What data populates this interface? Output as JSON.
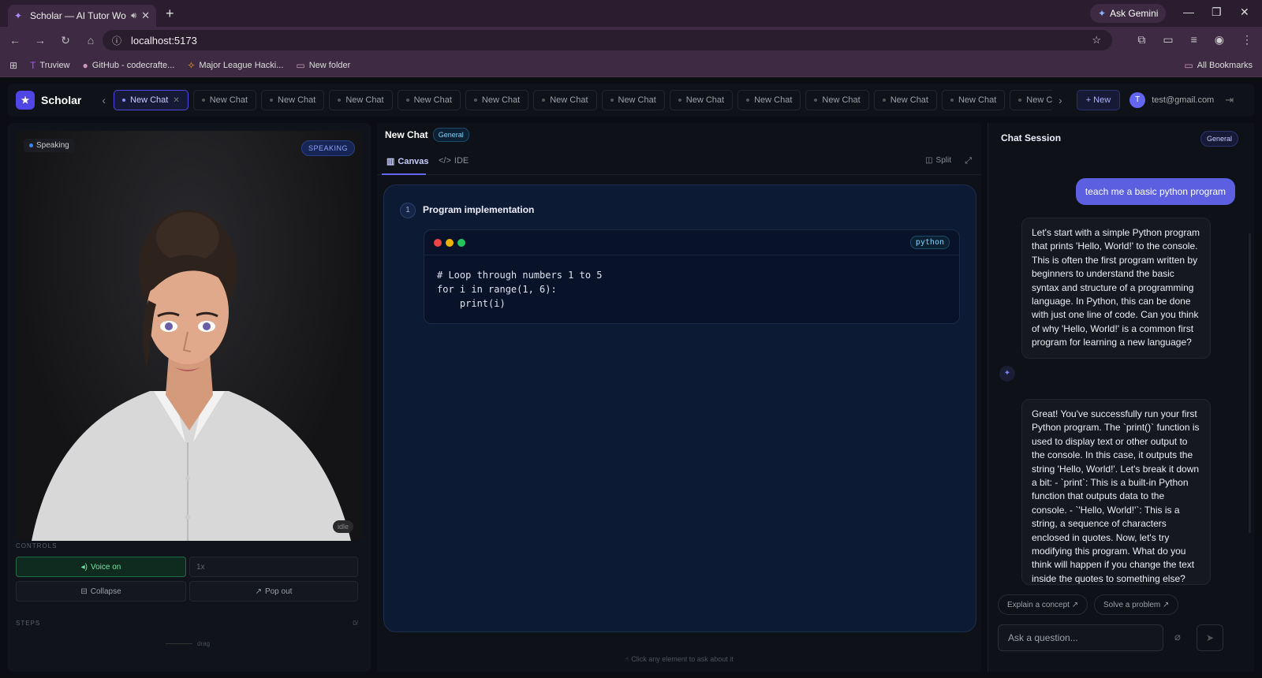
{
  "browser": {
    "tab_title": "Scholar — AI Tutor Worksp",
    "ask_gemini": "Ask Gemini",
    "url": "localhost:5173",
    "bookmarks": [
      "Truview",
      "GitHub - codecrafte...",
      "Major League Hacki...",
      "New folder"
    ],
    "all_bookmarks": "All Bookmarks"
  },
  "app": {
    "name": "Scholar",
    "chat_tabs": [
      "New Chat",
      "New Chat",
      "New Chat",
      "New Chat",
      "New Chat",
      "New Chat",
      "New Chat",
      "New Chat",
      "New Chat",
      "New Chat",
      "New Chat",
      "New Chat",
      "New Chat",
      "New Chat",
      "N"
    ],
    "new_label": "+ New",
    "user_initial": "T",
    "user_email": "test@gmail.com"
  },
  "left": {
    "status": "Speaking",
    "badge": "SPEAKING",
    "idle": "idle",
    "controls_label": "CONTROLS",
    "voice_on": "Voice on",
    "speed": "1x",
    "collapse": "Collapse",
    "pop_out": "Pop out",
    "steps_label": "STEPS",
    "steps_count": "0/",
    "drag": "drag"
  },
  "center": {
    "title": "New Chat",
    "category": "General",
    "tab_canvas": "Canvas",
    "tab_ide": "IDE",
    "split": "Split",
    "step_number": "1",
    "step_title": "Program implementation",
    "code_language": "python",
    "code": "# Loop through numbers 1 to 5\nfor i in range(1, 6):\n    print(i)",
    "hint": "Click any element to ask about it"
  },
  "right": {
    "title": "Chat Session",
    "category": "General",
    "user_message": "teach me a basic python program",
    "ai_message_1": "Let's start with a simple Python program that prints 'Hello, World!' to the console. This is often the first program written by beginners to understand the basic syntax and structure of a programming language. In Python, this can be done with just one line of code. Can you think of why 'Hello, World!' is a common first program for learning a new language?",
    "ai_message_2": "Great! You've successfully run your first Python program. The `print()` function is used to display text or other output to the console. In this case, it outputs the string 'Hello, World!'. Let's break it down a bit: - `print`: This is a built-in Python function that outputs data to the console. - `'Hello, World!'`: This is a string, a sequence of characters enclosed in quotes. Now, let's try modifying this program. What do you think will happen if you change the text inside the quotes to something else?",
    "suggestion_1": "Explain a concept ↗",
    "suggestion_2": "Solve a problem ↗",
    "input_placeholder": "Ask a question..."
  },
  "colors": {
    "accent": "#6366f1",
    "voice_green": "#6ee7a8",
    "chrome": "#3e2a42"
  }
}
